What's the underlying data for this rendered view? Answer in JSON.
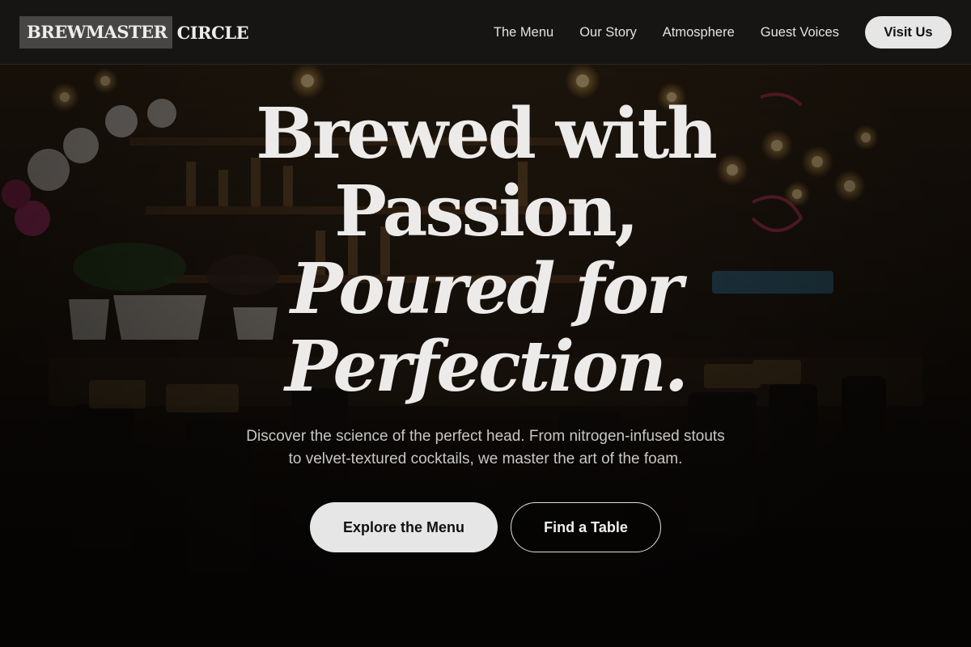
{
  "brand": {
    "main": "BREWMASTER",
    "sub": "CIRCLE"
  },
  "nav": {
    "links": [
      "The Menu",
      "Our Story",
      "Atmosphere",
      "Guest Voices"
    ],
    "cta_label": "Visit Us"
  },
  "hero": {
    "headline_line1": "Brewed with",
    "headline_line2": "Passion,",
    "headline_line3": "Poured for",
    "headline_line4": "Perfection.",
    "subtext_line1": "Discover the science of the perfect head. From nitrogen-infused stouts",
    "subtext_line2": "to velvet-textured cocktails, we master the art of the foam.",
    "primary_button": "Explore the Menu",
    "secondary_button": "Find a Table",
    "background_image": "dim bar interior with hanging Edison bulbs, orchids, bottle shelves and bar stools"
  },
  "colors": {
    "header_bg": "#161514",
    "brand_box": "#474645",
    "text_light": "#ecebea",
    "button_bg": "#e6e6e6",
    "page_bg": "#0c0a08"
  }
}
